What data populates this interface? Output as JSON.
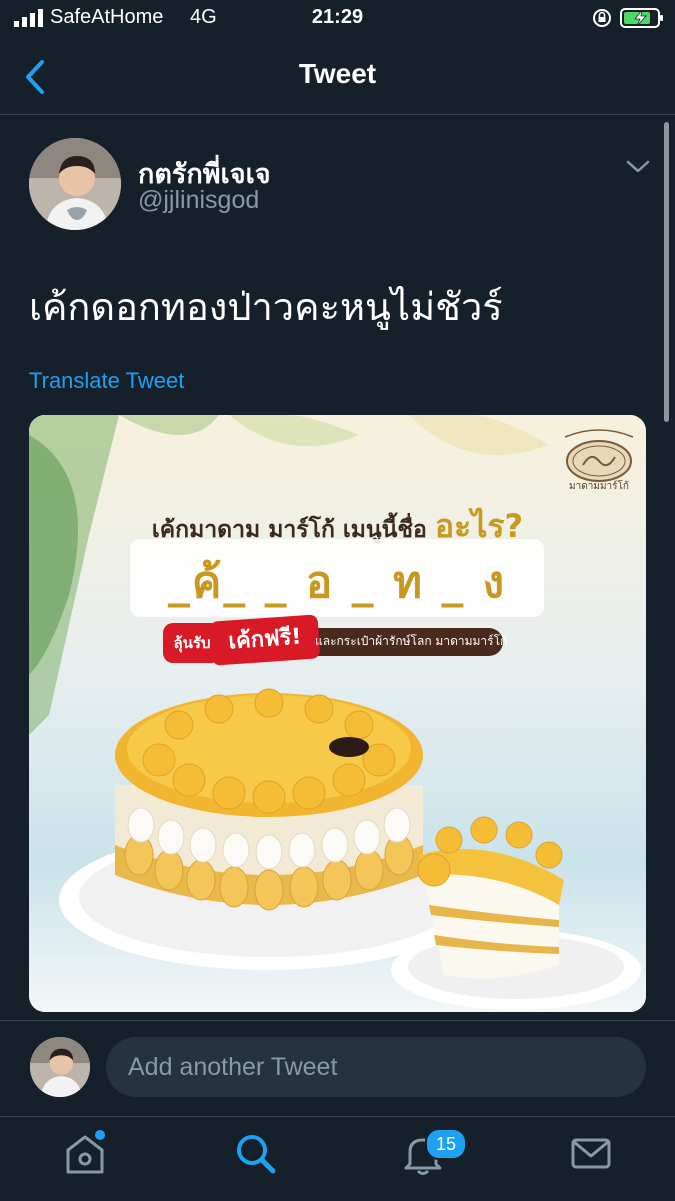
{
  "status_bar": {
    "carrier": "SafeAtHome",
    "network": "4G",
    "time": "21:29",
    "icons": [
      "signal-icon",
      "orientation-lock-icon",
      "battery-charging-icon"
    ]
  },
  "nav": {
    "title": "Tweet",
    "back_icon": "chevron-left-icon"
  },
  "tweet": {
    "display_name": "กตรักพี่เจเจ",
    "handle": "@jjlinisgod",
    "text": "เค้กดอกทองป่าวคะหนูไม่ชัวร์",
    "translate_label": "Translate Tweet",
    "media": {
      "question_prefix": "เค้กมาดาม มาร์โก้ เมนูนี้ชื่อ",
      "question_accent": "อะไร?",
      "puzzle": "_ค้_ _ อ _ ท _ ง",
      "prize_tag": "ลุ้นรับ",
      "prize_main": "เค้กฟรี!",
      "prize_rest": "และกระเป๋าผ้ารักษ์โลก มาดามมาร์โก้",
      "logo_caption": "มาดามมาร์โก้"
    }
  },
  "reply": {
    "placeholder": "Add another Tweet"
  },
  "tabbar": {
    "notifications_count": "15",
    "home_has_dot": true
  },
  "colors": {
    "background": "#15202b",
    "accent": "#1da1f2",
    "secondary_text": "#8899a6",
    "divider": "#38444d",
    "gold": "#c8991f",
    "promo_red": "#d71a25"
  }
}
